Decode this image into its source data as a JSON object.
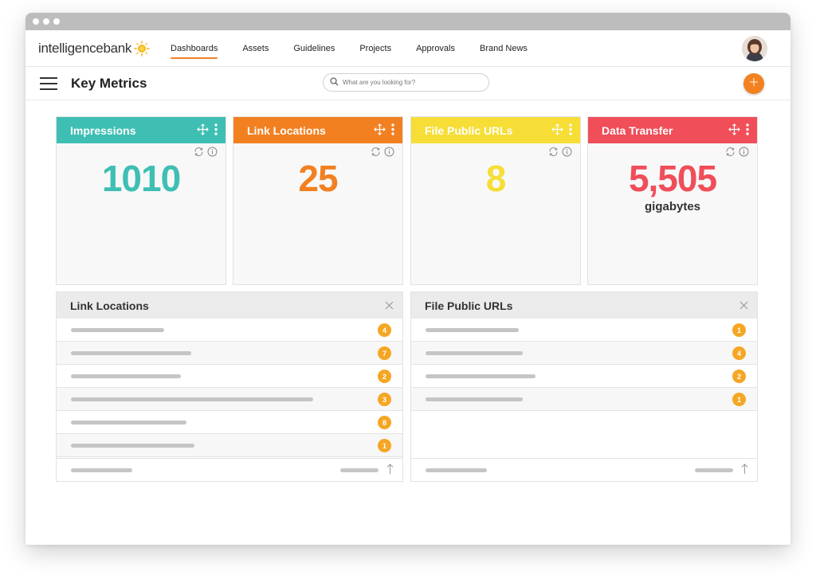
{
  "brand": {
    "name": "intelligencebank"
  },
  "nav": {
    "items": [
      {
        "label": "Dashboards",
        "active": true
      },
      {
        "label": "Assets"
      },
      {
        "label": "Guidelines"
      },
      {
        "label": "Projects"
      },
      {
        "label": "Approvals"
      },
      {
        "label": "Brand News"
      }
    ]
  },
  "header": {
    "title": "Key Metrics",
    "search_placeholder": "What are you looking for?",
    "add_icon": "plus-icon",
    "menu_icon": "hamburger-icon"
  },
  "cards": [
    {
      "title": "Impressions",
      "value": "1010",
      "unit": "",
      "color": "#3fbfb3"
    },
    {
      "title": "Link Locations",
      "value": "25",
      "unit": "",
      "color": "#f28021"
    },
    {
      "title": "File Public URLs",
      "value": "8",
      "unit": "",
      "color": "#f6de37"
    },
    {
      "title": "Data Transfer",
      "value": "5,505",
      "unit": "gigabytes",
      "color": "#f04e59"
    }
  ],
  "panels": [
    {
      "title": "Link Locations",
      "counts": [
        "4",
        "7",
        "2",
        "3",
        "8",
        "1"
      ]
    },
    {
      "title": "File Public URLs",
      "counts": [
        "1",
        "4",
        "2",
        "1"
      ]
    }
  ],
  "colors": {
    "accent": "#f07f2a",
    "badge": "#f5a623",
    "placeholder_bar": "#c5c5c5"
  }
}
